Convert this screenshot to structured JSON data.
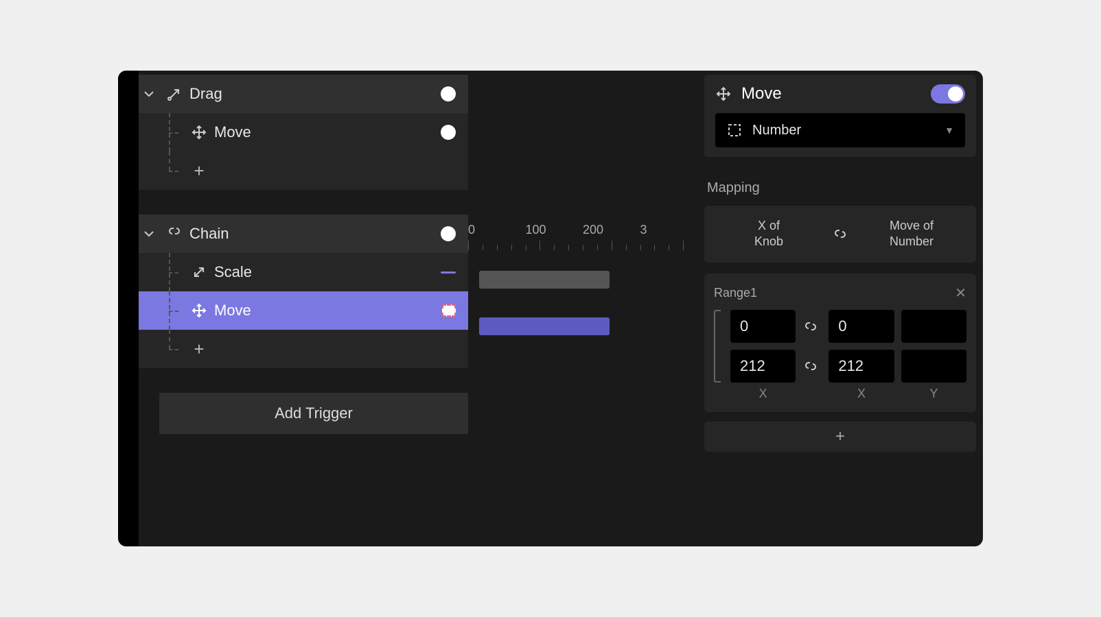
{
  "tree": {
    "drag": {
      "label": "Drag",
      "children": {
        "move": "Move"
      }
    },
    "chain": {
      "label": "Chain",
      "children": {
        "scale": "Scale",
        "move": "Move"
      }
    }
  },
  "add_trigger_label": "Add Trigger",
  "timeline": {
    "ticks": [
      "0",
      "100",
      "200",
      "3"
    ]
  },
  "inspector": {
    "title": "Move",
    "target": "Number",
    "mapping_label": "Mapping",
    "mapping": {
      "from_line1": "X of",
      "from_line2": "Knob",
      "to_line1": "Move of",
      "to_line2": "Number"
    },
    "range_label": "Range1",
    "range": {
      "from_x_min": "0",
      "to_x_min": "0",
      "to_y_min": "",
      "from_x_max": "212",
      "to_x_max": "212",
      "to_y_max": "",
      "axis_from": "X",
      "axis_to_x": "X",
      "axis_to_y": "Y"
    }
  }
}
